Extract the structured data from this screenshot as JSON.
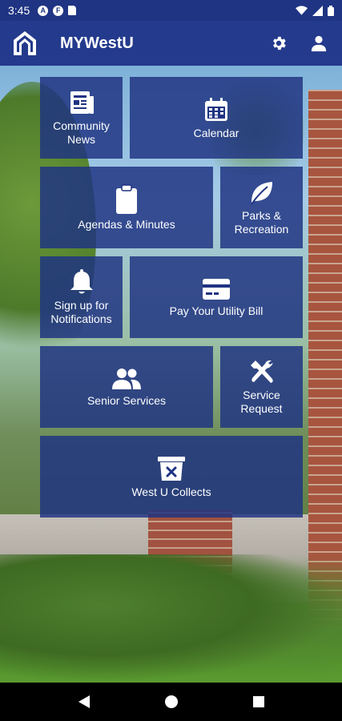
{
  "status_bar": {
    "time": "3:45",
    "notif_a": "A",
    "notif_b": "F"
  },
  "app_bar": {
    "title": "MYWestU"
  },
  "tiles": {
    "community_news": "Community News",
    "calendar": "Calendar",
    "agendas": "Agendas & Minutes",
    "parks": "Parks & Recreation",
    "notifications": "Sign up for Notifications",
    "pay_bill": "Pay Your Utility Bill",
    "senior": "Senior Services",
    "service_request": "Service Request",
    "collects": "West U Collects"
  },
  "icons": {
    "app_logo": "house-logo-icon",
    "settings": "gear-icon",
    "account": "person-icon",
    "news": "newspaper-icon",
    "calendar": "calendar-icon",
    "agendas": "clipboard-icon",
    "parks": "leaf-icon",
    "notifications": "bell-icon",
    "pay": "credit-card-icon",
    "senior": "users-icon",
    "service": "tools-icon",
    "collects": "trash-bin-icon"
  },
  "colors": {
    "brand": "#243a8c",
    "tile": "#1f3382"
  }
}
